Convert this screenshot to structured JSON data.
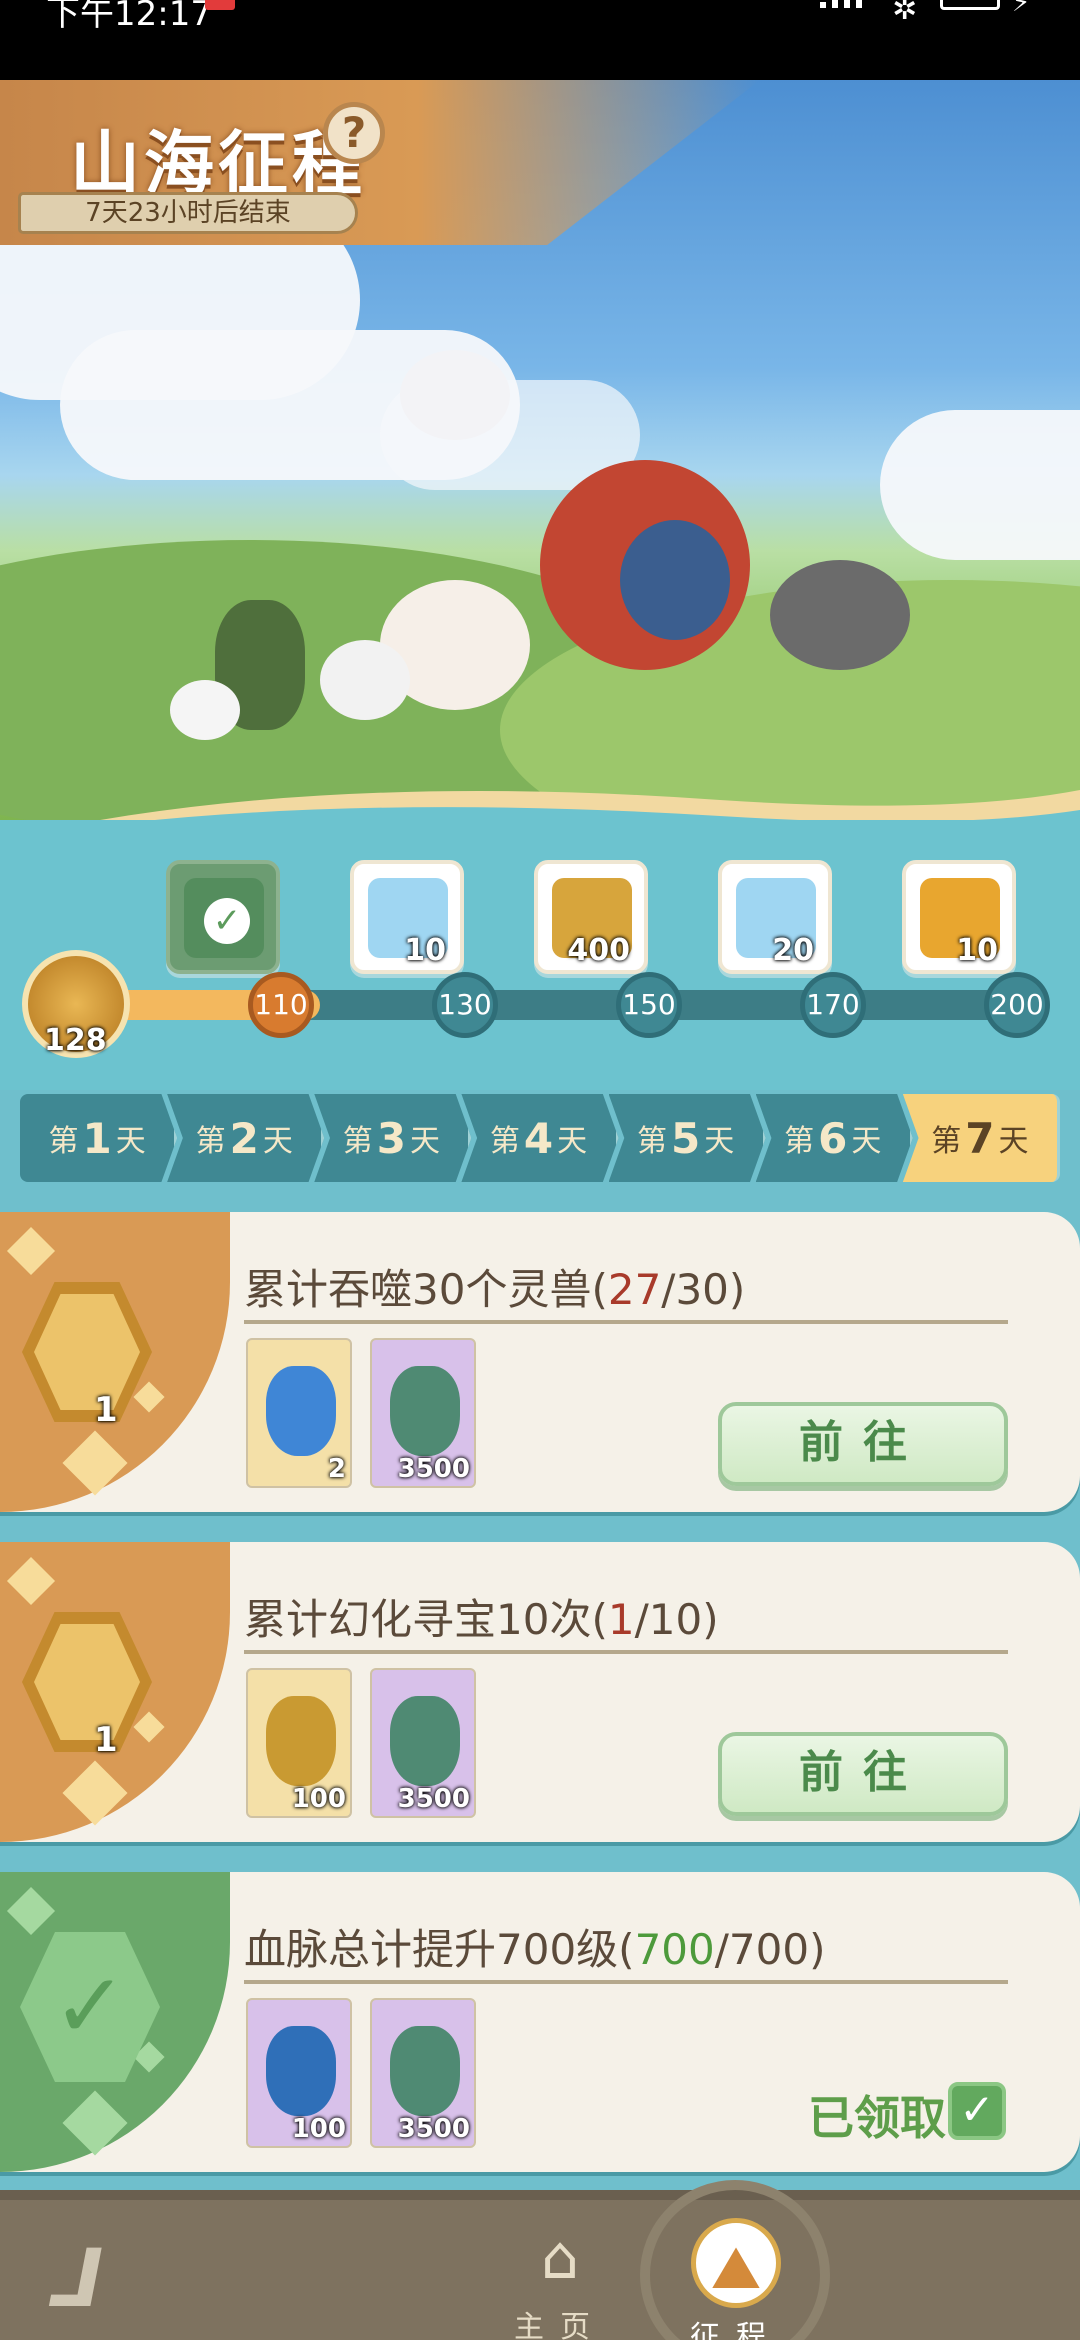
{
  "status_bar": {
    "time": "下午12:17"
  },
  "banner": {
    "title": "山海征程",
    "help_symbol": "?",
    "countdown": "7天23小时后结束"
  },
  "progress": {
    "current_points": "128",
    "rewards": [
      {
        "icon": "jade-armor-icon",
        "count": "",
        "claimed": true,
        "color": "#6c9c72"
      },
      {
        "icon": "puzzle-piece-icon",
        "count": "10",
        "claimed": false,
        "color": "#9fd6f2"
      },
      {
        "icon": "gold-armor-icon",
        "count": "400",
        "claimed": false,
        "color": "#d7a53c"
      },
      {
        "icon": "puzzle-piece-icon",
        "count": "20",
        "claimed": false,
        "color": "#9fd6f2"
      },
      {
        "icon": "golden-scroll-icon",
        "count": "10",
        "claimed": false,
        "color": "#e8a62f"
      }
    ],
    "milestones": [
      "110",
      "130",
      "150",
      "170",
      "200"
    ],
    "fill_fraction": 0.25
  },
  "days": [
    {
      "prefix": "第",
      "num": "1",
      "suffix": "天",
      "active": false
    },
    {
      "prefix": "第",
      "num": "2",
      "suffix": "天",
      "active": false
    },
    {
      "prefix": "第",
      "num": "3",
      "suffix": "天",
      "active": false
    },
    {
      "prefix": "第",
      "num": "4",
      "suffix": "天",
      "active": false
    },
    {
      "prefix": "第",
      "num": "5",
      "suffix": "天",
      "active": false
    },
    {
      "prefix": "第",
      "num": "6",
      "suffix": "天",
      "active": false
    },
    {
      "prefix": "第",
      "num": "7",
      "suffix": "天",
      "active": true
    }
  ],
  "tasks": [
    {
      "title": "累计吞噬30个灵兽",
      "current": "27",
      "total": "30",
      "reward_points": "1",
      "items": [
        {
          "icon": "blue-vase-icon",
          "qty": "2",
          "bg": "gold"
        },
        {
          "icon": "jade-leaf-icon",
          "qty": "3500",
          "bg": "purple"
        }
      ],
      "button": "前往",
      "done": false
    },
    {
      "title": "累计幻化寻宝10次",
      "current": "1",
      "total": "10",
      "reward_points": "1",
      "items": [
        {
          "icon": "gold-leaf-icon",
          "qty": "100",
          "bg": "gold"
        },
        {
          "icon": "jade-leaf-icon",
          "qty": "3500",
          "bg": "purple"
        }
      ],
      "button": "前往",
      "done": false
    },
    {
      "title": "血脉总计提升700级",
      "current": "700",
      "total": "700",
      "reward_points": "",
      "items": [
        {
          "icon": "blue-gem-icon",
          "qty": "100",
          "bg": "purple"
        },
        {
          "icon": "jade-leaf-icon",
          "qty": "3500",
          "bg": "purple"
        }
      ],
      "button": "已领取",
      "done": true
    }
  ],
  "nav": {
    "items": [
      {
        "label": "主页",
        "icon": "home-icon",
        "active": false
      },
      {
        "label": "征程",
        "icon": "journey-icon",
        "active": true
      }
    ]
  }
}
